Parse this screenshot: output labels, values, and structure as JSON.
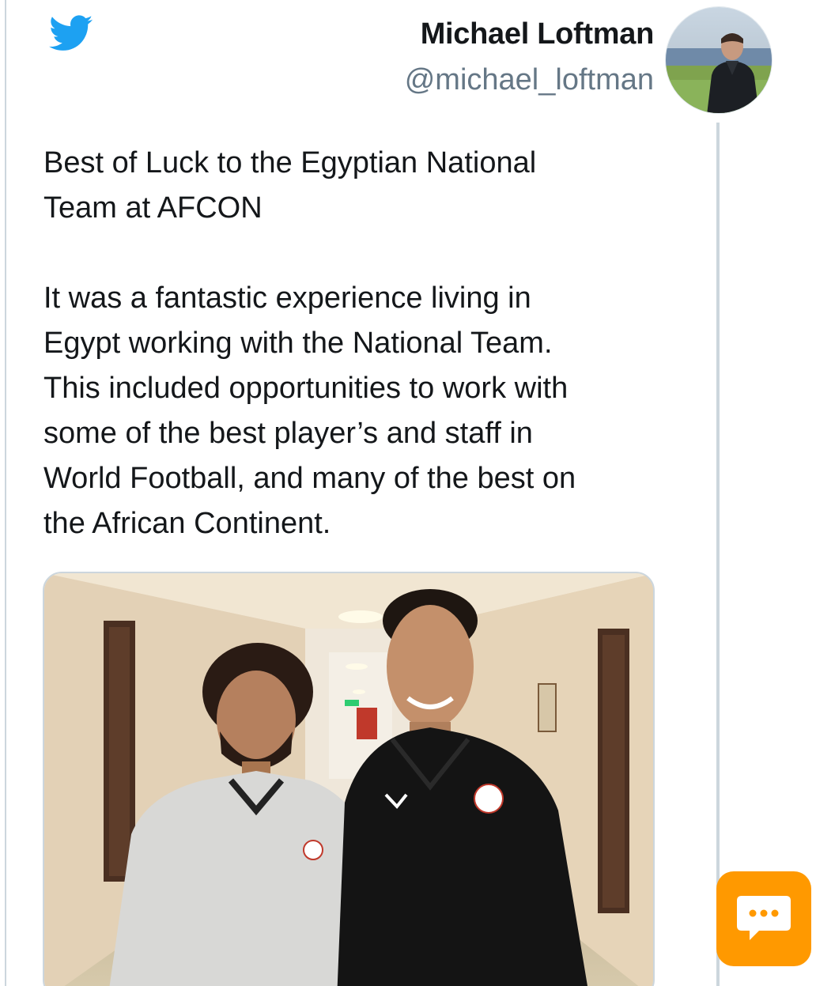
{
  "author": {
    "name": "Michael Loftman",
    "handle": "@michael_loftman"
  },
  "tweet": {
    "paragraphs": [
      "Best of Luck to the Egyptian National\nTeam at AFCON",
      "It was a fantastic experience living in\nEgypt working with the National Team.\nThis included opportunities to work with\nsome of the best player’s and staff in\nWorld Football, and many of the best on\nthe African Continent."
    ]
  },
  "icons": {
    "logo": "twitter-bird-icon",
    "chat": "chat-bubble-icon"
  },
  "colors": {
    "twitter_blue": "#1da1f2",
    "handle_gray": "#657786",
    "border_gray": "#ccd6dd",
    "chat_orange": "#ff9900"
  }
}
